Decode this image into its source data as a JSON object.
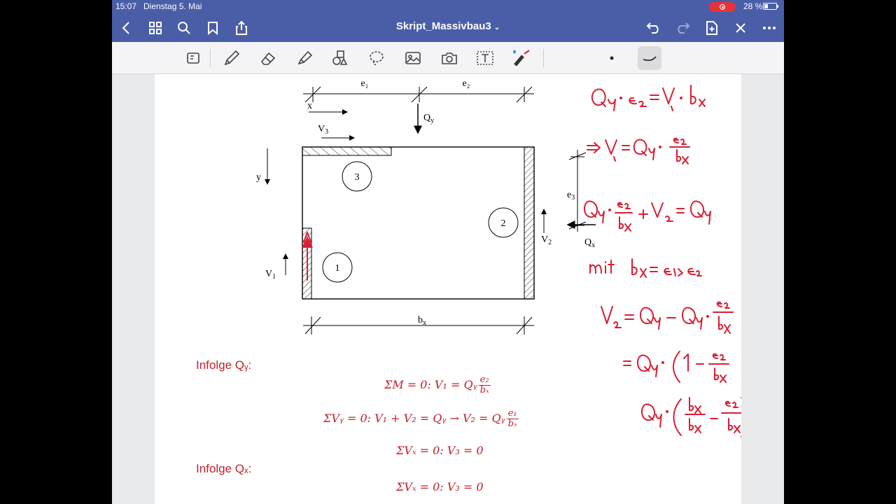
{
  "status": {
    "time": "15:07",
    "date": "Dienstag 5. Mai",
    "battery": "28 %"
  },
  "document": {
    "title": "Skript_Massivbau3",
    "title_chevron": "⌄"
  },
  "diagram": {
    "e1": "e₁",
    "e2": "e₂",
    "e3": "e₃",
    "x": "x",
    "y": "y",
    "Qy": "Q_y",
    "Qx": "Q_x",
    "V1": "V₁",
    "V2": "V₂",
    "V3": "V₃",
    "bx": "bₓ",
    "wall1": "1",
    "wall2": "2",
    "wall3": "3"
  },
  "content": {
    "infolge_qy": "Infolge Qᵧ:",
    "eq1_left": "ΣM = 0:   V₁ = Qᵧ",
    "eq1_num": "e₂",
    "eq1_den": "bₓ",
    "eq2_left": "ΣVᵧ = 0:   V₁ + V₂ = Qᵧ   →   V₂ = Qᵧ",
    "eq2_num": "e₁",
    "eq2_den": "bₓ",
    "eq3": "ΣVₓ = 0:   V₃ = 0",
    "infolge_qx": "Infolge Qₓ:",
    "eq4": "ΣVₓ = 0:   V₃ = 0"
  },
  "handwriting": {
    "line1": "Qy · e2 = V1 · bx",
    "line2": "⇒ V1 = Qy · e2/bx",
    "line3": "Qy · e2/bx + V2 = Qy",
    "line4": "mit bx = e1 + e2",
    "line5": "V2 = Qy − Qy · e2/bx",
    "line6": "= Qy · (1 − e2/bx)",
    "line7": "Qy · (bx/bx − e2/bx)"
  },
  "colors": {
    "bar": "#4a5ea8",
    "red": "#c0202c",
    "ink": "#d81f33"
  }
}
